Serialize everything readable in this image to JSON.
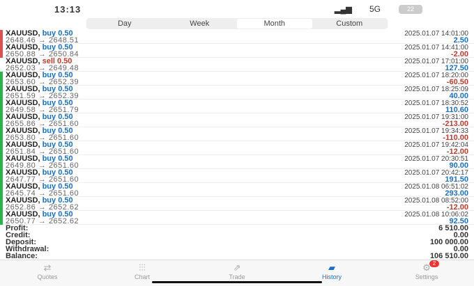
{
  "status": {
    "time": "13:13",
    "network": "5G",
    "battery": "22"
  },
  "periods": [
    "Day",
    "Week",
    "Month",
    "Custom"
  ],
  "active_period": "Month",
  "deals": [
    {
      "symbol": "XAUUSD,",
      "side": "buy",
      "volume": "0.50",
      "open": "2648.46",
      "close": "2648.51",
      "time": "2025.01.07 14:01:00",
      "profit": "2.50",
      "bar": "#d9534f"
    },
    {
      "symbol": "XAUUSD,",
      "side": "buy",
      "volume": "0.50",
      "open": "2650.88",
      "close": "2650.84",
      "time": "2025.01.07 14:41:00",
      "profit": "-2.00",
      "bar": "#d9534f"
    },
    {
      "symbol": "XAUUSD,",
      "side": "sell",
      "volume": "0.50",
      "open": "2652.03",
      "close": "2649.48",
      "time": "2025.01.07 17:01:00",
      "profit": "127.50",
      "bar": ""
    },
    {
      "symbol": "XAUUSD,",
      "side": "buy",
      "volume": "0.50",
      "open": "2653.60",
      "close": "2652.39",
      "time": "2025.01.07 18:20:00",
      "profit": "-60.50",
      "bar": "#2bb34a"
    },
    {
      "symbol": "XAUUSD,",
      "side": "buy",
      "volume": "0.50",
      "open": "2651.59",
      "close": "2652.39",
      "time": "2025.01.07 18:25:09",
      "profit": "40.00",
      "bar": "#2bb34a"
    },
    {
      "symbol": "XAUUSD,",
      "side": "buy",
      "volume": "0.50",
      "open": "2649.58",
      "close": "2651.79",
      "time": "2025.01.07 18:30:52",
      "profit": "110.60",
      "bar": "#2bb34a"
    },
    {
      "symbol": "XAUUSD,",
      "side": "buy",
      "volume": "0.50",
      "open": "2655.86",
      "close": "2651.60",
      "time": "2025.01.07 19:31:00",
      "profit": "-213.00",
      "bar": "#2bb34a"
    },
    {
      "symbol": "XAUUSD,",
      "side": "buy",
      "volume": "0.50",
      "open": "2653.80",
      "close": "2651.60",
      "time": "2025.01.07 19:34:33",
      "profit": "-110.00",
      "bar": "#2bb34a"
    },
    {
      "symbol": "XAUUSD,",
      "side": "buy",
      "volume": "0.50",
      "open": "2651.84",
      "close": "2651.60",
      "time": "2025.01.07 19:42:04",
      "profit": "-12.00",
      "bar": "#2bb34a"
    },
    {
      "symbol": "XAUUSD,",
      "side": "buy",
      "volume": "0.50",
      "open": "2649.80",
      "close": "2651.60",
      "time": "2025.01.07 20:30:51",
      "profit": "90.00",
      "bar": "#2bb34a"
    },
    {
      "symbol": "XAUUSD,",
      "side": "buy",
      "volume": "0.50",
      "open": "2647.77",
      "close": "2651.60",
      "time": "2025.01.07 20:42:17",
      "profit": "191.50",
      "bar": "#2bb34a"
    },
    {
      "symbol": "XAUUSD,",
      "side": "buy",
      "volume": "0.50",
      "open": "2645.74",
      "close": "2651.60",
      "time": "2025.01.08 06:51:02",
      "profit": "293.00",
      "bar": "#2bb34a"
    },
    {
      "symbol": "XAUUSD,",
      "side": "buy",
      "volume": "0.50",
      "open": "2652.86",
      "close": "2652.62",
      "time": "2025.01.08 08:52:00",
      "profit": "-12.00",
      "bar": "#2bb34a"
    },
    {
      "symbol": "XAUUSD,",
      "side": "buy",
      "volume": "0.50",
      "open": "2650.77",
      "close": "2652.62",
      "time": "2025.01.08 10:06:02",
      "profit": "92.50",
      "bar": "#2bb34a"
    }
  ],
  "summary": [
    {
      "label": "Profit:",
      "value": "6 510.00"
    },
    {
      "label": "Credit:",
      "value": "0.00"
    },
    {
      "label": "Deposit:",
      "value": "100 000.00"
    },
    {
      "label": "Withdrawal:",
      "value": "0.00"
    },
    {
      "label": "Balance:",
      "value": "106 510.00"
    }
  ],
  "tabs": [
    {
      "label": "Quotes",
      "icon": "⇄"
    },
    {
      "label": "Chart",
      "icon": "⫶⫶⫶"
    },
    {
      "label": "Trade",
      "icon": "⇗"
    },
    {
      "label": "History",
      "icon": "▰"
    },
    {
      "label": "Settings",
      "icon": "⚙",
      "badge": "2"
    }
  ],
  "active_tab": "History",
  "colors": {
    "blue": "#1a6fc4",
    "red": "#c0392b"
  }
}
